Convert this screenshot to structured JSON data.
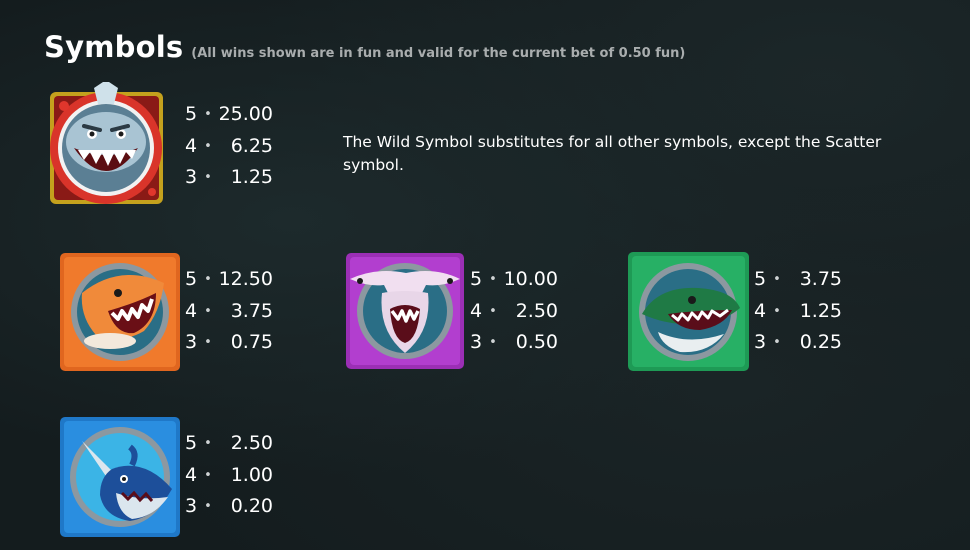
{
  "header": {
    "title": "Symbols",
    "subtitle": "(All wins shown are in fun and valid for the current bet of 0.50 fun)"
  },
  "wild_description": "The Wild Symbol substitutes for all other symbols, except the Scatter symbol.",
  "symbols": [
    {
      "name": "wild-shark",
      "color": "#c0392b",
      "pays": [
        {
          "count": "5",
          "value": "25.00"
        },
        {
          "count": "4",
          "value": "6.25"
        },
        {
          "count": "3",
          "value": "1.25"
        }
      ]
    },
    {
      "name": "orange-shark",
      "color": "#e0661f",
      "pays": [
        {
          "count": "5",
          "value": "12.50"
        },
        {
          "count": "4",
          "value": "3.75"
        },
        {
          "count": "3",
          "value": "0.75"
        }
      ]
    },
    {
      "name": "purple-hammerhead",
      "color": "#9b2fb5",
      "pays": [
        {
          "count": "5",
          "value": "10.00"
        },
        {
          "count": "4",
          "value": "2.50"
        },
        {
          "count": "3",
          "value": "0.50"
        }
      ]
    },
    {
      "name": "green-shark",
      "color": "#1e9a55",
      "pays": [
        {
          "count": "5",
          "value": "3.75"
        },
        {
          "count": "4",
          "value": "1.25"
        },
        {
          "count": "3",
          "value": "0.25"
        }
      ]
    },
    {
      "name": "blue-swordfish",
      "color": "#1f78c8",
      "pays": [
        {
          "count": "5",
          "value": "2.50"
        },
        {
          "count": "4",
          "value": "1.00"
        },
        {
          "count": "3",
          "value": "0.20"
        }
      ]
    }
  ]
}
